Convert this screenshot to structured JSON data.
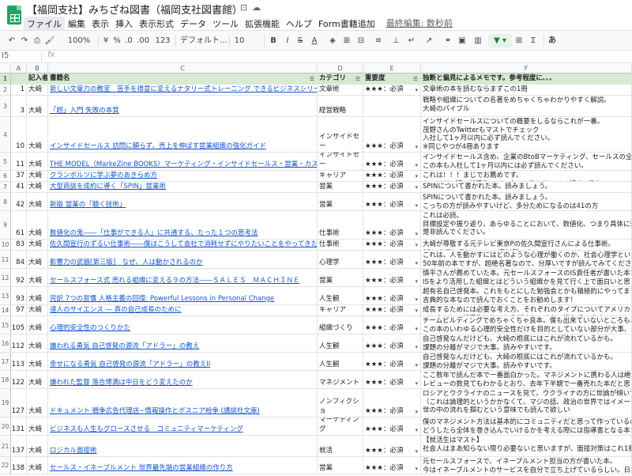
{
  "app": {
    "title": "【福岡支社】みちざね図書（福岡支社図書館）",
    "last_edit": "最終編集: 数秒前"
  },
  "menu": [
    "ファイル",
    "編集",
    "表示",
    "挿入",
    "表示形式",
    "データ",
    "ツール",
    "拡張機能",
    "ヘルプ",
    "Form書籍追加"
  ],
  "toolbar": {
    "zoom": "100%",
    "yen": "¥",
    "percent": "%",
    "dec1": ".0",
    "dec2": ".00",
    "numfmt": "123",
    "font": "デフォルト...",
    "size": "10",
    "bold": "B",
    "italic": "I",
    "strike": "S",
    "textcolor": "A",
    "sum": "Σ",
    "input": "あ"
  },
  "formula": {
    "cell": "I5",
    "fx": "fx"
  },
  "columns": [
    "A",
    "B",
    "C",
    "D",
    "E",
    "F"
  ],
  "header": {
    "rownum": "1",
    "b": "記入者",
    "c": "書籍名",
    "d": "カテゴリ",
    "e": "重要度",
    "f": "独断と偏見によるメモです。参考程度に、、、"
  },
  "rows": [
    {
      "num": "2",
      "id": "1",
      "who": "大崎",
      "title": "新しい文章力の教室　苦手を得意に変えるナタリー式トレーニング できるビジネスシリーズ",
      "cat": "文章術",
      "stars": "★★★：必須",
      "memo": [
        "文章術の本を読むならまずこの1冊"
      ]
    },
    {
      "num": "3",
      "id": "3",
      "who": "大崎",
      "title": "「超」入門 失敗の本質",
      "cat": "経営戦略",
      "stars": "",
      "memo": [
        "戦略や組織についての名著をめちゃくちゃわかりやすく解説。",
        "大崎のバイブル"
      ]
    },
    {
      "num": "4",
      "id": "10",
      "who": "大崎",
      "title": "インサイドセールス 訪問に頼らず、売上を伸ばす営業組織の強化ガイド",
      "cat": "インサイドセー",
      "stars": "★★★：必須",
      "memo": [
        "インサイドセールスについての概要をしるならこれが一番。",
        "茂野さんのTwitterもマストでチェック",
        "入社して1ヶ月以内に必ず読んでください。",
        "※同じやつが4冊あります"
      ]
    },
    {
      "num": "5",
      "id": "11",
      "who": "大崎",
      "title": "THE MODEL（MarkeZine BOOKS）マーケティング・インサイドセールス・営業・カスタマ",
      "cat": "インサイドセー",
      "stars": "★★★：必須",
      "memo": [
        "インサイドセールス含め、企業のBtoBマーケティング、セールスの全体の流れを理解する",
        "この本も入社して1ヶ月以内には必ず読んでください。"
      ]
    },
    {
      "num": "6",
      "id": "37",
      "who": "大崎",
      "title": "クランボルツに学ぶ夢のあきらめ方",
      "cat": "キャリア",
      "stars": "★★★：必須",
      "memo": [
        "これは！！！まじでお薦めです。",
        "キャリア、特に就活生、インターン生にはマジで読んで欲しい"
      ]
    },
    {
      "num": "7",
      "id": "41",
      "who": "大崎",
      "title": "大型商談を成約に導く「SPIN」営業術",
      "cat": "営業",
      "stars": "★★★：必須",
      "memo": [
        "SPINについて書かれた本。読みましょう。"
      ]
    },
    {
      "num": "8",
      "id": "42",
      "who": "大崎",
      "title": "新版 営業の「聴く技術」",
      "cat": "営業",
      "stars": "★★★：必須",
      "memo": [
        "SPINについて書かれた本。読みましょう。",
        "こっちの方が読みやすいけど、多分ためになるのは41の方"
      ]
    },
    {
      "num": "9",
      "id": "61",
      "who": "大崎",
      "title": "数値化の鬼――「仕事ができる人」に共通する、たった１つの思考法",
      "cat": "仕事術",
      "stars": "★★★：必須",
      "memo": [
        "これは必読。",
        "目標設定や振り返り、あらゆることにおいて、数値化、つまり具体に落とし込めるか。",
        "是非読んでください。"
      ]
    },
    {
      "num": "10",
      "id": "83",
      "who": "大崎",
      "title": "佐久間宣行のずるい仕事術――僕はこうして会社で消耗せずにやりたいことをやってきた",
      "cat": "仕事術",
      "stars": "★★★：必須",
      "memo": [
        "大崎が尊敬する元テレビ東京Pの佐久間宣行さんによる仕事術。",
        "85にあるトラリーマンの真似例です。"
      ]
    },
    {
      "num": "11",
      "id": "84",
      "who": "大崎",
      "title": "影響力の武器[第三版]　なぜ、人は動かされるのか",
      "cat": "心理学",
      "stars": "★★★：必須",
      "memo": [
        "これは、人を動かすにはどのような心理が働くのか、社会心理学という学問として、",
        "50年前の本ですが、超絶名著なので、分厚いですが読んでみてください。"
      ]
    },
    {
      "num": "12",
      "id": "92",
      "who": "大崎",
      "title": "セールスフォース式 売れる組織に変える９の方法――ＳＡＬＥＳ　ＭＡＣＨＩＮＥ",
      "cat": "営業",
      "stars": "★★★：必須",
      "memo": [
        "慎平さんが薦めていた本。元セールスフォースのIS責任者が書いた本です。",
        "ISをより活用した組織とはどういう組織かを見て行く上で面白いと思う"
      ]
    },
    {
      "num": "13",
      "id": "93",
      "who": "大崎",
      "title": "完訳 7つの習慣 人格主義の回復: Powerful Lessons in Personal Change",
      "cat": "人生観",
      "stars": "★★★：必須",
      "memo": [
        "超有名自己啓発本。これをもとにした勉強会とかも積極的にやってます。",
        "吉典的な本なので読んでおくことをお勧めします！"
      ]
    },
    {
      "num": "14",
      "id": "97",
      "who": "大崎",
      "title": "達人のサイエンス ― 真の自己成長のために",
      "cat": "キャリア",
      "stars": "★★★：必須",
      "memo": [
        "成長するためには必要な考え方、それぞれのタイプについてアメリカ人の合気道の達人が書いた本",
        "インターンの就活生にはこちらがめちゃくちゃ推しています"
      ]
    },
    {
      "num": "15",
      "id": "105",
      "who": "大崎",
      "title": "心理的安全性のつくりかた",
      "cat": "組織づくり",
      "stars": "★★★：必須",
      "memo": [
        "チームビルディングでめちゃくちゃ良本。僕も出来ていないところもあるけど、",
        "この本のいわゆる心理的安全性だけを目的としていない部分が大事、心理的安全性をどうやって"
      ]
    },
    {
      "num": "16",
      "id": "112",
      "who": "大崎",
      "title": "嫌われる勇気 自己啓発の源流「アドラー」の教え",
      "cat": "人生観",
      "stars": "★★★：必須",
      "memo": [
        "自己啓発なんだけども、大崎の根底にはこれが流れているかも。",
        "課題の分離がマジで大事。読みやすいです。"
      ]
    },
    {
      "num": "17",
      "id": "113",
      "who": "大崎",
      "title": "幸せになる勇気 自己啓発の源流「アドラー」の教えII",
      "cat": "人生観",
      "stars": "★★★：必須",
      "memo": [
        "自己啓発なんだけども、大崎の根底にはこれが流れているかも。",
        "課題の分離がマジで大事。読みやすいです。"
      ]
    },
    {
      "num": "18",
      "id": "122",
      "who": "大崎",
      "title": "嫌われた監督 落合博満は中日をどう変えたのか",
      "cat": "マネジメント",
      "stars": "★★★：必須",
      "memo": [
        "ここ数年で読んだ本で一番面白かった。マネジメントに携わる人は絶対に読んで欲しい",
        "レビューの数見てもわかるとおり、去年下半期で一番売れた本だと思う。"
      ]
    },
    {
      "num": "19",
      "id": "127",
      "who": "大崎",
      "title": "ドキュメント 戦争広告代理店~情報操作とボスニア紛争 (講談社文庫)",
      "cat": "ノンフィクショ",
      "stars": "★★★：必須",
      "memo": [
        "ロシアとウクライナのニュースを見て、ウクライナの方に世論が傾いていて、",
        "（これは論理的というかかなくて、マジの話、政治の世界ではイメージが大事）",
        "世の中の流れを掴むという意味でも読んで欲しい"
      ]
    },
    {
      "num": "20",
      "id": "131",
      "who": "大崎",
      "title": "ビジネスも人生もグロースさせる　コミュニティマーケティング",
      "cat": "マーケティング",
      "stars": "★★★：必須",
      "memo": [
        "僕のマネジメント方法は基本的にコミュニティだと思って作っているので",
        "どうしたら全体を巻き込んでいけるかを考える際には指導書となる本です"
      ]
    },
    {
      "num": "21",
      "id": "137",
      "who": "大崎",
      "title": "ロジカル面接術",
      "cat": "就活",
      "stars": "★★★：必須",
      "memo": [
        "【就活生はマスト】",
        "社会人はまあ知らない限り必要ないと思いますが、面接対策はこれ1冊で十分です"
      ]
    },
    {
      "num": "22",
      "id": "138",
      "who": "大崎",
      "title": "セールス・イネーブルメント 世界最先端の営業組織の作り方",
      "cat": "営業",
      "stars": "★★★：必須",
      "memo": [
        "元セールスフォースで、イネーブルメント担当の方が書いた本。",
        "今はイネーブルメントのサービスを自分で立ち上げているらしい。日本の"
      ]
    }
  ]
}
